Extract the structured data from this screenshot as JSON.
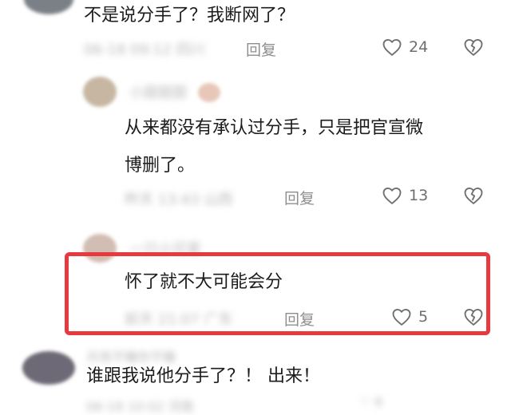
{
  "comments": [
    {
      "text": "不是说分手了？我断网了？",
      "reply_label": "回复",
      "likes": "24"
    },
    {
      "text_lines": [
        "从来都没有承认过分手，只是把官宣微",
        "博删了。"
      ],
      "reply_label": "回复",
      "likes": "13"
    },
    {
      "text": "怀了就不大可能会分",
      "reply_label": "回复",
      "likes": "5"
    },
    {
      "text": "谁跟我说他分手了？！ 出来！"
    }
  ],
  "colors": {
    "highlight": "#e63a3f",
    "icon_gray": "#6f6f6f",
    "meta_gray": "#8e8e8e"
  }
}
